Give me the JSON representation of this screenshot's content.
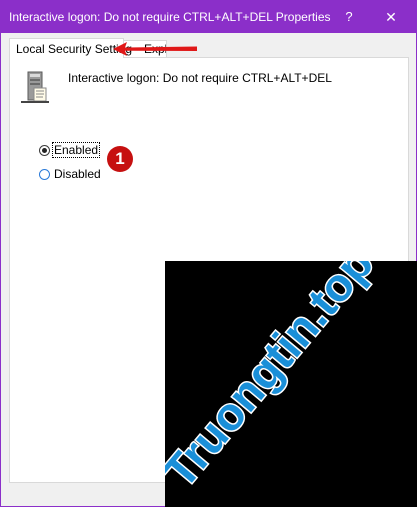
{
  "window": {
    "title": "Interactive logon: Do not require CTRL+ALT+DEL Properties",
    "help_glyph": "?",
    "close_glyph": "✕",
    "titlebar_color": "#8b2fc9"
  },
  "tabs": [
    {
      "label": "Local Security Setting",
      "active": true
    },
    {
      "label": "Explain",
      "active": false
    }
  ],
  "policy": {
    "icon": "policy-server-icon",
    "description": "Interactive logon: Do not require CTRL+ALT+DEL"
  },
  "options": {
    "enabled_label": "Enabled",
    "disabled_label": "Disabled",
    "selected": "Enabled"
  },
  "annotation": {
    "step_number": "1",
    "arrow_color": "#e01818"
  },
  "watermark": {
    "text": "Truongtin.top",
    "color": "#1a8fd8"
  }
}
